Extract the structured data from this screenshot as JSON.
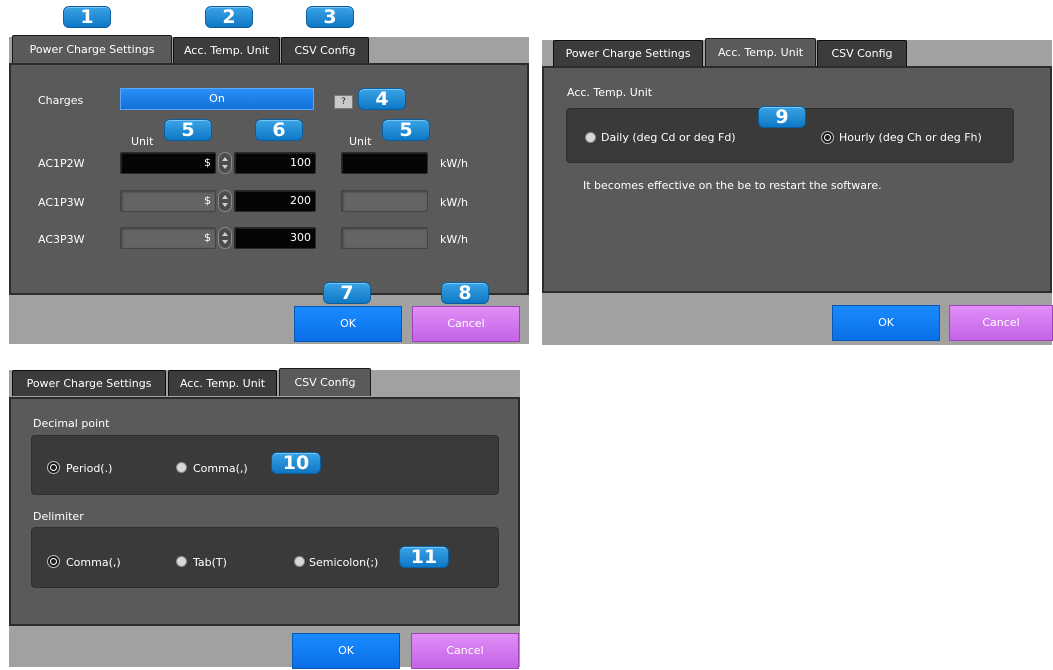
{
  "tabs": {
    "power_charge_settings": "Power Charge Settings",
    "acc_temp_unit": "Acc. Temp. Unit",
    "csv_config": "CSV Config"
  },
  "badges": {
    "b1": "1",
    "b2": "2",
    "b3": "3",
    "b4": "4",
    "b5": "5",
    "b6": "6",
    "b7": "7",
    "b8": "8",
    "b9": "9",
    "b10": "10",
    "b11": "11"
  },
  "power": {
    "charges_label": "Charges",
    "charges_value": "On",
    "help_label": "?",
    "unit_header": "Unit",
    "rows": [
      {
        "name": "AC1P2W",
        "unit": "$",
        "value": "100",
        "kwh_unit": "kW/h"
      },
      {
        "name": "AC1P3W",
        "unit": "$",
        "value": "200",
        "kwh_unit": "kW/h"
      },
      {
        "name": "AC3P3W",
        "unit": "$",
        "value": "300",
        "kwh_unit": "kW/h"
      }
    ]
  },
  "temp": {
    "group_title": "Acc. Temp. Unit",
    "daily": "Daily (deg Cd or deg Fd)",
    "hourly": "Hourly (deg Ch or deg Fh)",
    "note": "It becomes effective on the be to restart the software."
  },
  "csv": {
    "decimal_title": "Decimal point",
    "period": "Period(.)",
    "comma_dec": "Comma(,)",
    "delimiter_title": "Delimiter",
    "comma_delim": "Comma(,)",
    "tab": "Tab(T)",
    "semicolon": "Semicolon(;)"
  },
  "buttons": {
    "ok": "OK",
    "cancel": "Cancel"
  }
}
